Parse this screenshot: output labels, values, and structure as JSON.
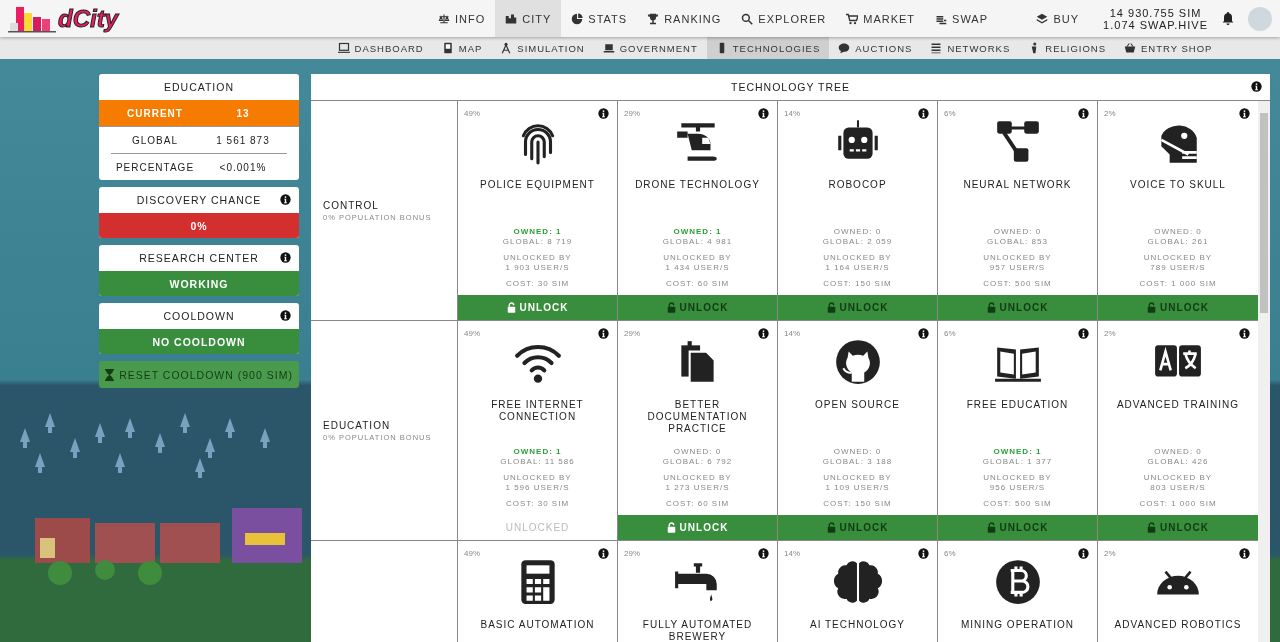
{
  "header": {
    "logo": "dCity",
    "nav": [
      {
        "label": "INFO",
        "selected": false
      },
      {
        "label": "CITY",
        "selected": true
      },
      {
        "label": "STATS",
        "selected": false
      },
      {
        "label": "RANKING",
        "selected": false
      },
      {
        "label": "EXPLORER",
        "selected": false
      },
      {
        "label": "MARKET",
        "selected": false
      },
      {
        "label": "SWAP",
        "selected": false
      }
    ],
    "buy": "BUY",
    "balance": [
      "14 930.755 SIM",
      "1.074 SWAP.HIVE"
    ]
  },
  "subnav": [
    {
      "label": "DASHBOARD",
      "selected": false
    },
    {
      "label": "MAP",
      "selected": false
    },
    {
      "label": "SIMULATION",
      "selected": false
    },
    {
      "label": "GOVERNMENT",
      "selected": false
    },
    {
      "label": "TECHNOLOGIES",
      "selected": true
    },
    {
      "label": "AUCTIONS",
      "selected": false
    },
    {
      "label": "NETWORKS",
      "selected": false
    },
    {
      "label": "RELIGIONS",
      "selected": false
    },
    {
      "label": "ENTRY SHOP",
      "selected": false
    }
  ],
  "education": {
    "title": "EDUCATION",
    "rows": [
      {
        "label": "CURRENT",
        "value": "13",
        "selected": true
      },
      {
        "label": "GLOBAL",
        "value": "1 561 873",
        "selected": false
      },
      {
        "label": "PERCENTAGE",
        "value": "<0.001%",
        "selected": false
      }
    ]
  },
  "status_panels": [
    {
      "title": "DISCOVERY CHANCE",
      "value": "0%",
      "color": "#d32f2f"
    },
    {
      "title": "RESEARCH CENTER",
      "value": "WORKING",
      "color": "#388e3c"
    },
    {
      "title": "COOLDOWN",
      "value": "NO COOLDOWN",
      "color": "#388e3c"
    }
  ],
  "reset_button": {
    "label": "RESET COOLDOWN (900 SIM)",
    "disabled": true
  },
  "tech_tree": {
    "title": "TECHNOLOGY TREE",
    "rows": [
      {
        "category": "CONTROL",
        "bonus": "0% POPULATION BONUS",
        "techs": [
          {
            "chance": "49%",
            "name": "POLICE EQUIPMENT",
            "owned": "OWNED: 1",
            "owned_active": true,
            "global": "GLOBAL: 8 719",
            "unlocked_by": "UNLOCKED BY",
            "users": "1 903 USER/S",
            "cost": "COST: 30 SIM",
            "action": {
              "kind": "button",
              "label": "UNLOCK",
              "disabled": false
            }
          },
          {
            "chance": "29%",
            "name": "DRONE TECHNOLOGY",
            "owned": "OWNED: 1",
            "owned_active": true,
            "global": "GLOBAL: 4 981",
            "unlocked_by": "UNLOCKED BY",
            "users": "1 434 USER/S",
            "cost": "COST: 60 SIM",
            "action": {
              "kind": "button",
              "label": "UNLOCK",
              "disabled": true
            }
          },
          {
            "chance": "14%",
            "name": "ROBOCOP",
            "owned": "OWNED: 0",
            "owned_active": false,
            "global": "GLOBAL: 2 059",
            "unlocked_by": "UNLOCKED BY",
            "users": "1 164 USER/S",
            "cost": "COST: 150 SIM",
            "action": {
              "kind": "button",
              "label": "UNLOCK",
              "disabled": true
            }
          },
          {
            "chance": "6%",
            "name": "NEURAL NETWORK",
            "owned": "OWNED: 0",
            "owned_active": false,
            "global": "GLOBAL: 853",
            "unlocked_by": "UNLOCKED BY",
            "users": "957 USER/S",
            "cost": "COST: 500 SIM",
            "action": {
              "kind": "button",
              "label": "UNLOCK",
              "disabled": true
            }
          },
          {
            "chance": "2%",
            "name": "VOICE TO SKULL",
            "owned": "OWNED: 0",
            "owned_active": false,
            "global": "GLOBAL: 261",
            "unlocked_by": "UNLOCKED BY",
            "users": "789 USER/S",
            "cost": "COST: 1 000 SIM",
            "action": {
              "kind": "button",
              "label": "UNLOCK",
              "disabled": true
            }
          }
        ]
      },
      {
        "category": "EDUCATION",
        "bonus": "0% POPULATION BONUS",
        "techs": [
          {
            "chance": "49%",
            "name": "FREE INTERNET CONNECTION",
            "owned": "OWNED: 1",
            "owned_active": true,
            "global": "GLOBAL: 11 586",
            "unlocked_by": "UNLOCKED BY",
            "users": "1 596 USER/S",
            "cost": "COST: 30 SIM",
            "action": {
              "kind": "status",
              "label": "UNLOCKED"
            }
          },
          {
            "chance": "29%",
            "name": "BETTER DOCUMENTATION PRACTICE",
            "owned": "OWNED: 0",
            "owned_active": false,
            "global": "GLOBAL: 6 792",
            "unlocked_by": "UNLOCKED BY",
            "users": "1 273 USER/S",
            "cost": "COST: 60 SIM",
            "action": {
              "kind": "button",
              "label": "UNLOCK",
              "disabled": false
            }
          },
          {
            "chance": "14%",
            "name": "OPEN SOURCE",
            "owned": "OWNED: 0",
            "owned_active": false,
            "global": "GLOBAL: 3 188",
            "unlocked_by": "UNLOCKED BY",
            "users": "1 109 USER/S",
            "cost": "COST: 150 SIM",
            "action": {
              "kind": "button",
              "label": "UNLOCK",
              "disabled": true
            }
          },
          {
            "chance": "6%",
            "name": "FREE EDUCATION",
            "owned": "OWNED: 1",
            "owned_active": true,
            "global": "GLOBAL: 1 377",
            "unlocked_by": "UNLOCKED BY",
            "users": "956 USER/S",
            "cost": "COST: 500 SIM",
            "action": {
              "kind": "button",
              "label": "UNLOCK",
              "disabled": true
            }
          },
          {
            "chance": "2%",
            "name": "ADVANCED TRAINING",
            "owned": "OWNED: 0",
            "owned_active": false,
            "global": "GLOBAL: 426",
            "unlocked_by": "UNLOCKED BY",
            "users": "803 USER/S",
            "cost": "COST: 1 000 SIM",
            "action": {
              "kind": "button",
              "label": "UNLOCK",
              "disabled": true
            }
          }
        ]
      },
      {
        "techs": [
          {
            "chance": "49%",
            "name": "BASIC AUTOMATION"
          },
          {
            "chance": "29%",
            "name": "FULLY AUTOMATED BREWERY"
          },
          {
            "chance": "14%",
            "name": "AI TECHNOLOGY"
          },
          {
            "chance": "6%",
            "name": "MINING OPERATION"
          },
          {
            "chance": "2%",
            "name": "ADVANCED ROBOTICS"
          }
        ]
      }
    ]
  }
}
